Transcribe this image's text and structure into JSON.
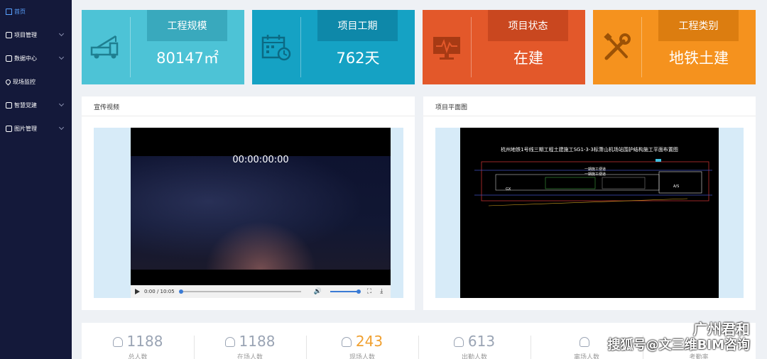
{
  "sidebar": {
    "items": [
      {
        "label": "首页",
        "icon": "home-icon",
        "active": true
      },
      {
        "label": "项目管理",
        "icon": "folder-icon"
      },
      {
        "label": "数据中心",
        "icon": "database-icon"
      },
      {
        "label": "现场监控",
        "icon": "location-icon"
      },
      {
        "label": "智慧党建",
        "icon": "party-icon"
      },
      {
        "label": "图片管理",
        "icon": "image-icon"
      }
    ]
  },
  "cards": [
    {
      "label": "工程规模",
      "value": "80147㎡",
      "color": "#4dc3d6",
      "label_bg": "#39a9bd",
      "icon": "crane-truck-icon"
    },
    {
      "label": "项目工期",
      "value": "762天",
      "color": "#15a2c4",
      "label_bg": "#0e88a9",
      "icon": "calendar-clock-icon"
    },
    {
      "label": "项目状态",
      "value": "在建",
      "color": "#e3582a",
      "label_bg": "#c9471f",
      "icon": "monitor-pulse-icon"
    },
    {
      "label": "工程类别",
      "value": "地铁土建",
      "color": "#f5921e",
      "label_bg": "#dc7d10",
      "icon": "tools-icon"
    }
  ],
  "video_panel": {
    "title": "宣传视频",
    "overlay_time": "00:00:00:00",
    "time_display": "0:00 / 10:05"
  },
  "plan_panel": {
    "title": "项目平面图",
    "drawing_title": "杭州地铁1号线三期工程土建施工SG1-3-3标萧山机场站围护结构施工平面布置图",
    "labels": [
      "一期施工便道",
      "一期施工便道",
      "GX",
      "A/S"
    ]
  },
  "stats": [
    {
      "number": "1188",
      "label": "总人数",
      "highlight": false
    },
    {
      "number": "1188",
      "label": "在场人数",
      "highlight": false
    },
    {
      "number": "243",
      "label": "现场人数",
      "highlight": true
    },
    {
      "number": "613",
      "label": "出勤人数",
      "highlight": false
    },
    {
      "number": "",
      "label": "离场人数",
      "highlight": false
    },
    {
      "number": "",
      "label": "考勤率",
      "highlight": false
    }
  ],
  "watermark": {
    "line1": "广州君和",
    "line2": "搜狐号@文三维BIM咨询"
  }
}
